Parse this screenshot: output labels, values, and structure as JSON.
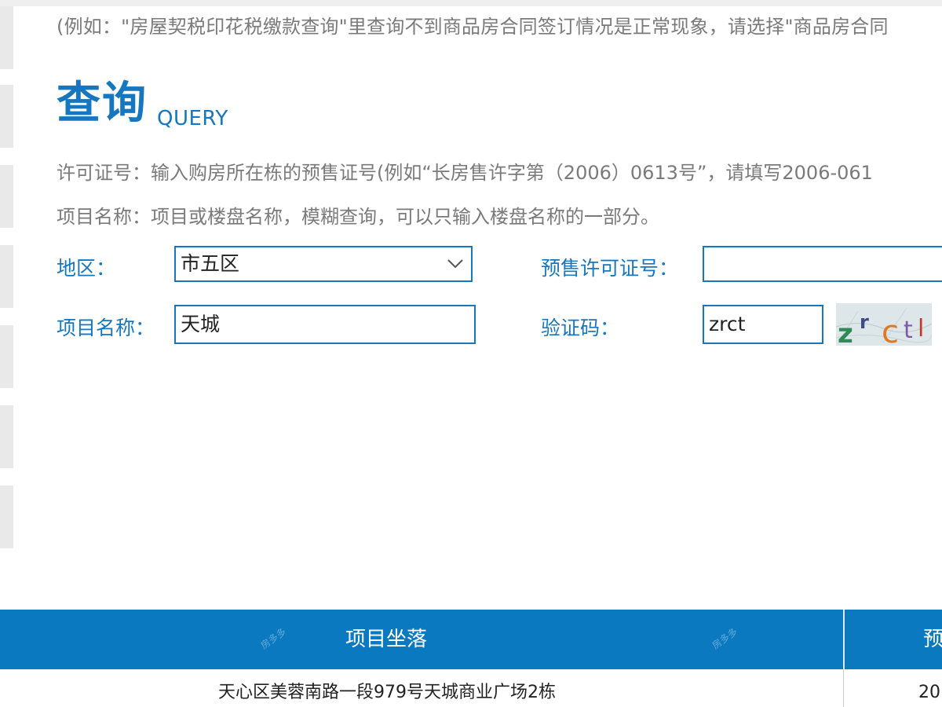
{
  "notice": "(例如：\"房屋契税印花税缴款查询\"里查询不到商品房合同签订情况是正常现象，请选择\"商品房合同",
  "query": {
    "title": "查询",
    "subtitle": "QUERY"
  },
  "hints": {
    "license": "许可证号：输入购房所在栋的预售证号(例如“长房售许字第（2006）0613号”，请填写2006-061",
    "project": "项目名称：项目或楼盘名称，模糊查询，可以只输入楼盘名称的一部分。"
  },
  "form": {
    "region_label": "地区：",
    "region_value": "市五区",
    "presale_label": "预售许可证号：",
    "presale_value": "",
    "project_label": "项目名称：",
    "project_value": "天城",
    "captcha_label": "验证码：",
    "captcha_value": "zrct",
    "captcha_image_text": "zrct"
  },
  "table": {
    "headers": [
      "项目坐落",
      "预"
    ],
    "rows": [
      [
        "天心区美蓉南路一段979号天城商业广场2栋",
        "20"
      ]
    ]
  },
  "watermark": "房多多",
  "icons": {
    "select": "chevron-down-icon"
  },
  "colors": {
    "accent": "#1577c0",
    "table_header": "#0b79c0",
    "hint_text": "#7a7a7a"
  }
}
